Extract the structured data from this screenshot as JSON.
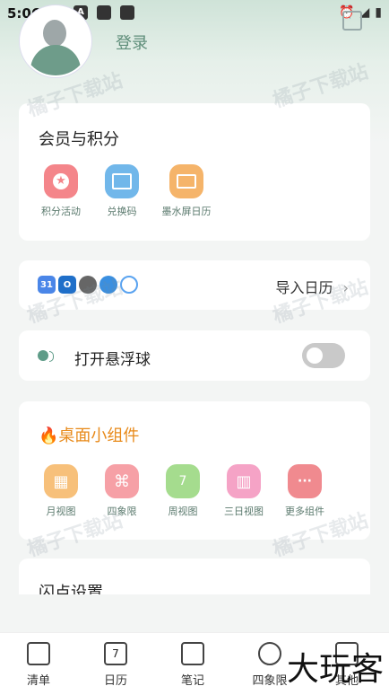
{
  "status_bar": {
    "time": "5:06",
    "icon_a": "A"
  },
  "header": {
    "login_label": "登录"
  },
  "membership": {
    "title": "会员与积分",
    "items": [
      {
        "label": "积分活动",
        "icon": "star-icon",
        "color": "#f4858a"
      },
      {
        "label": "兑换码",
        "icon": "gift-icon",
        "color": "#71b7ea"
      },
      {
        "label": "墨水屏日历",
        "icon": "screen-icon",
        "color": "#f5b46a"
      }
    ]
  },
  "import_calendar": {
    "label": "导入日历",
    "chevron": "›",
    "mini_icons": [
      "31",
      "O",
      "",
      "",
      ""
    ]
  },
  "float_ball": {
    "label": "打开悬浮球",
    "enabled": false
  },
  "widgets": {
    "title": "桌面小组件",
    "fire_icon": "🔥",
    "items": [
      {
        "label": "月视图",
        "icon": "calendar-grid-icon",
        "color": "#f7c07a",
        "glyph": "▦"
      },
      {
        "label": "四象限",
        "icon": "quadrant-icon",
        "color": "#f6a0a6",
        "glyph": "⌘"
      },
      {
        "label": "周视图",
        "icon": "week-icon",
        "color": "#a5dc8e",
        "glyph": "7"
      },
      {
        "label": "三日视图",
        "icon": "three-day-icon",
        "color": "#f5a3c6",
        "glyph": "▥"
      },
      {
        "label": "更多组件",
        "icon": "more-icon",
        "color": "#f08a8f",
        "glyph": "···"
      }
    ]
  },
  "flash_settings": {
    "title": "闪点设置"
  },
  "tabbar": {
    "tabs": [
      {
        "label": "清单",
        "icon": "checklist-icon"
      },
      {
        "label": "日历",
        "icon": "calendar-icon",
        "glyph": "7"
      },
      {
        "label": "笔记",
        "icon": "note-icon"
      },
      {
        "label": "四象限",
        "icon": "quadrant-icon"
      },
      {
        "label": "其他",
        "icon": "more-icon"
      }
    ]
  },
  "watermark": {
    "text": "橘子下载站",
    "big": "大玩客"
  }
}
